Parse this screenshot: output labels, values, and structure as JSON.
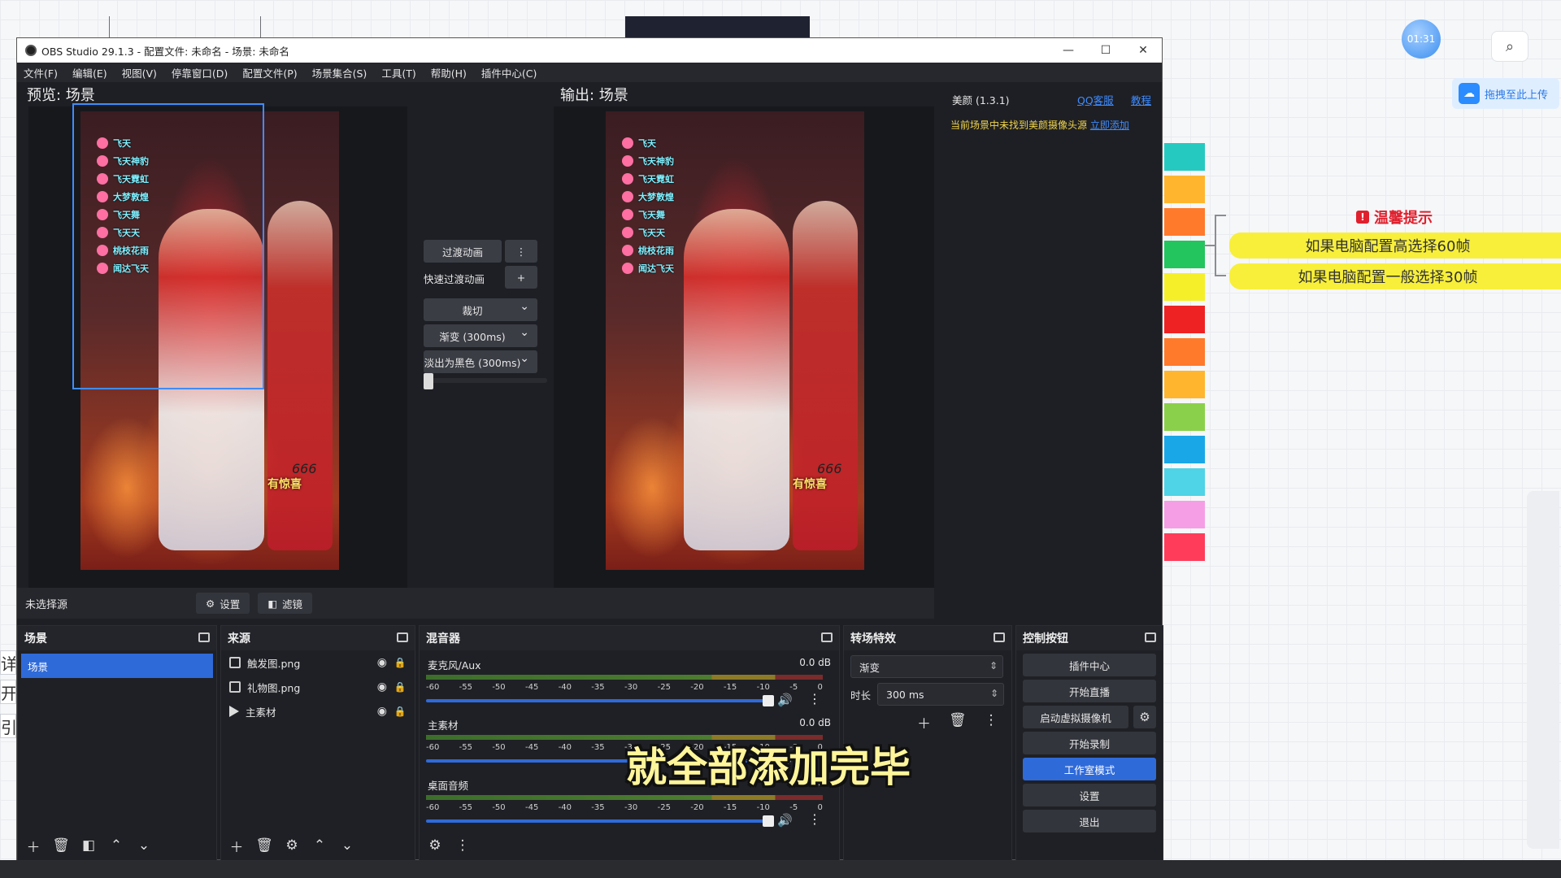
{
  "app": {
    "title": "OBS Studio 29.1.3 - 配置文件: 未命名 - 场景: 未命名",
    "window_controls": [
      "—",
      "☐",
      "✕"
    ]
  },
  "menu": [
    "文件(F)",
    "编辑(E)",
    "视图(V)",
    "停靠窗口(D)",
    "配置文件(P)",
    "场景集合(S)",
    "工具(T)",
    "帮助(H)",
    "插件中心(C)"
  ],
  "preview": {
    "label": "预览: 场景",
    "gifts": [
      "飞天",
      "飞天神豹",
      "飞天霓虹",
      "大梦敦煌",
      "飞天舞",
      "飞天天",
      "桃枝花雨",
      "闻达飞天"
    ],
    "overlay_text": "有惊喜",
    "overlay_num": "666"
  },
  "program": {
    "label": "输出: 场景"
  },
  "transition_controls": {
    "transition_btn": "过渡动画",
    "quick_label": "快速过渡动画",
    "options": [
      "裁切",
      "渐变 (300ms)",
      "淡出为黑色 (300ms)"
    ]
  },
  "beauty": {
    "title": "美颜 (1.3.1)",
    "qq": "QQ客服",
    "tutorial": "教程",
    "warning": "当前场景中未找到美颜摄像头源",
    "add_link": "立即添加"
  },
  "status": {
    "no_source": "未选择源",
    "settings": "设置",
    "filters": "滤镜"
  },
  "scenes": {
    "title": "场景",
    "items": [
      "场景"
    ]
  },
  "sources": {
    "title": "来源",
    "items": [
      {
        "name": "触发图.png",
        "type": "image"
      },
      {
        "name": "礼物图.png",
        "type": "image"
      },
      {
        "name": "主素材",
        "type": "media"
      }
    ]
  },
  "mixer": {
    "title": "混音器",
    "ticks": [
      "-60",
      "-55",
      "-50",
      "-45",
      "-40",
      "-35",
      "-30",
      "-25",
      "-20",
      "-15",
      "-10",
      "-5",
      "0"
    ],
    "channels": [
      {
        "name": "麦克风/Aux",
        "db": "0.0 dB"
      },
      {
        "name": "主素材",
        "db": "0.0 dB"
      },
      {
        "name": "桌面音频",
        "db": "0.0 dB"
      }
    ]
  },
  "transitions": {
    "title": "转场特效",
    "current": "渐变",
    "duration_label": "时长",
    "duration": "300 ms"
  },
  "controls": {
    "title": "控制按钮",
    "plugin_center": "插件中心",
    "start_stream": "开始直播",
    "virtual_cam": "启动虚拟摄像机",
    "start_record": "开始录制",
    "studio_mode": "工作室模式",
    "settings": "设置",
    "exit": "退出"
  },
  "subtitle": "就全部添加完毕",
  "background": {
    "timer": "01:31",
    "upload": "拖拽至此上传",
    "tip_title": "温馨提示",
    "tip_lines": [
      "如果电脑配置高选择60帧",
      "如果电脑配置一般选择30帧"
    ],
    "left_fragments": [
      "详",
      "开",
      "引"
    ],
    "swatches": [
      "#26c9c0",
      "#ffb62e",
      "#ff7a2a",
      "#22c55e",
      "#f5ef2a",
      "#ee2222",
      "#ff7a2a",
      "#ffb62e",
      "#8bd04a",
      "#1aa7e8",
      "#4fd3e6",
      "#f59ee5",
      "#ff3c5a"
    ]
  }
}
